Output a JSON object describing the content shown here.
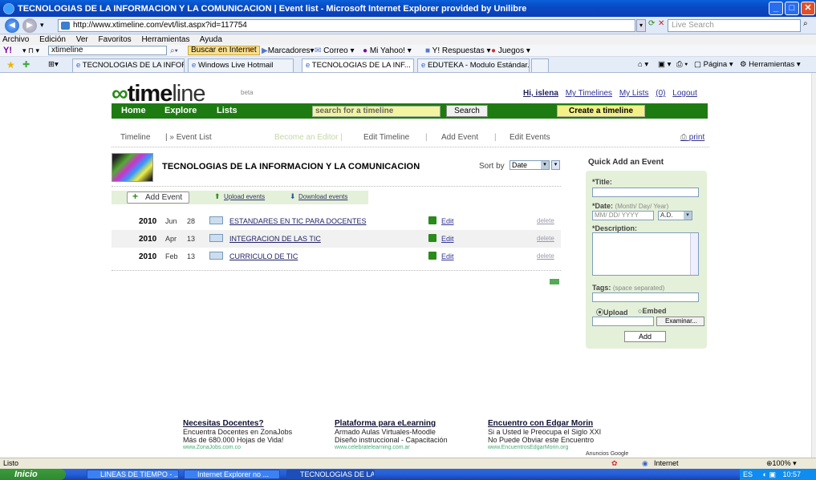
{
  "window": {
    "title": "TECNOLOGIAS DE LA INFORMACION Y LA COMUNICACION | Event list - Microsoft Internet Explorer provided by Unilibre"
  },
  "browser": {
    "address": "http://www.xtimeline.com/evt/list.aspx?id=117754",
    "search_placeholder": "Live Search",
    "menu": [
      "Archivo",
      "Edición",
      "Ver",
      "Favoritos",
      "Herramientas",
      "Ayuda"
    ],
    "yahoo_search_value": "xtimeline",
    "yahoo_search_button": "Buscar en Internet",
    "yahoo_items": [
      "Marcadores",
      "Correo",
      "Mi Yahoo!",
      "Y! Respuestas",
      "Juegos"
    ],
    "tabs": [
      "TECNOLOGIAS DE LA INFOR...",
      "Windows Live Hotmail",
      "TECNOLOGIAS DE LA INF...",
      "EDUTEKA - Modulo Estándar..."
    ],
    "toolbar_right": [
      "Página",
      "Herramientas"
    ]
  },
  "site": {
    "logo": {
      "main": "time",
      "line": "line"
    },
    "beta": "beta",
    "user_links": {
      "greeting": "Hi, islena",
      "my_timelines": "My Timelines",
      "my_lists": "My Lists",
      "count": "(0)",
      "logout": "Logout"
    },
    "nav": {
      "home": "Home",
      "explore": "Explore",
      "lists": "Lists",
      "search_placeholder": "search for a timeline",
      "search_button": "Search",
      "create": "Create a timeline"
    },
    "subnav": {
      "timeline": "Timeline",
      "event_list": "| » Event List",
      "become_editor": "Become an Editor |",
      "edit_timeline": "Edit Timeline",
      "sep1": "|",
      "add_event": "Add Event",
      "sep2": "|",
      "edit_events": "Edit Events",
      "print": "print"
    },
    "timeline_title": "TECNOLOGIAS DE LA INFORMACION Y LA COMUNICACION",
    "sort": {
      "label": "Sort by",
      "value": "Date"
    },
    "actions": {
      "add_event": "Add Event",
      "upload": "Upload events",
      "download": "Download events"
    },
    "events": [
      {
        "year": "2010",
        "month": "Jun",
        "day": "28",
        "name": "ESTANDARES EN TIC PARA DOCENTES",
        "edit": "Edit",
        "delete": "delete"
      },
      {
        "year": "2010",
        "month": "Apr",
        "day": "13",
        "name": "INTEGRACION DE LAS TIC",
        "edit": "Edit",
        "delete": "delete"
      },
      {
        "year": "2010",
        "month": "Feb",
        "day": "13",
        "name": "CURRICULO DE TIC",
        "edit": "Edit",
        "delete": "delete"
      }
    ],
    "quick_add": {
      "title": "Quick Add an Event",
      "title_label": "*Title:",
      "date_label": "*Date:",
      "date_hint": "(Month/ Day/ Year)",
      "date_placeholder": "MM/ DD/ YYYY",
      "era": "A.D.",
      "description_label": "*Description:",
      "tags_label": "Tags:",
      "tags_hint": "(space separated)",
      "upload": "Upload",
      "embed": "Embed",
      "browse": "Examinar...",
      "add": "Add"
    },
    "ads": [
      {
        "headline": "Necesitas Docentes?",
        "line1": "Encuentra Docentes en ZonaJobs",
        "line2": "Más de 680.000 Hojas de Vida!",
        "url": "www.ZonaJobs.com.co"
      },
      {
        "headline": "Plataforma para eLearning",
        "line1": "Armado Aulas Virtuales-Moodle",
        "line2": "Diseño instruccional - Capacitación",
        "url": "www.celebratelearning.com.ar"
      },
      {
        "headline": "Encuentro con Edgar Morin",
        "line1": "Si a Usted le Preocupa el Siglo XXI",
        "line2": "No Puede Obviar este Encuentro",
        "url": "www.EncuentrosEdgarMorin.org"
      }
    ],
    "ads_label": "Anuncios Google"
  },
  "status": {
    "text": "Listo",
    "zone": "Internet",
    "zoom": "100%"
  },
  "taskbar": {
    "start": "Inicio",
    "tasks": [
      "LINEAS DE TIEMPO - ...",
      "Internet Explorer no ...",
      "TECNOLOGIAS DE LA..."
    ],
    "lang": "ES",
    "clock": "10:57"
  }
}
